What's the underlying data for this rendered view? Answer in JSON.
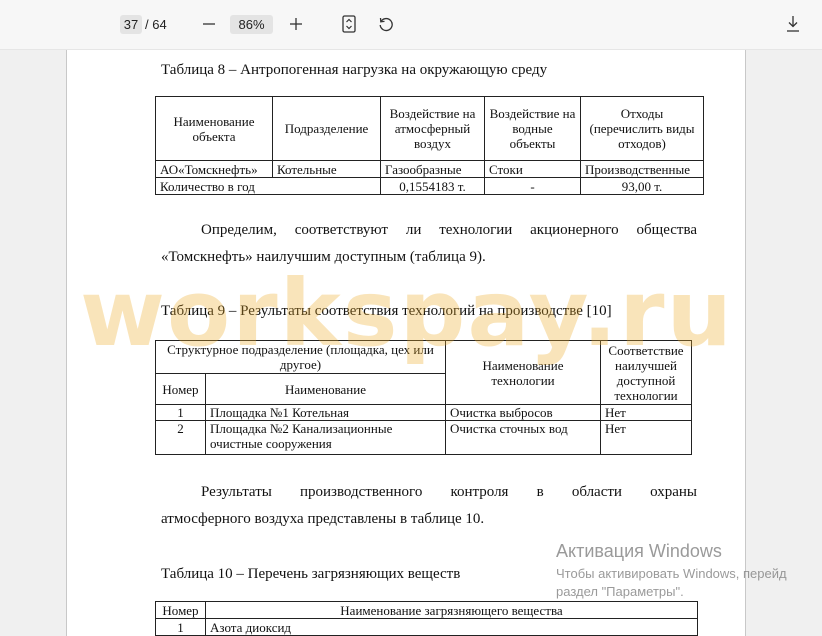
{
  "toolbar": {
    "current_page": "37",
    "total_pages": "/ 64",
    "zoom": "86%",
    "icons": [
      "minus-icon",
      "plus-icon",
      "fit-page-icon",
      "rotate-icon",
      "download-icon"
    ]
  },
  "document": {
    "table8": {
      "caption": "Таблица 8 – Антропогенная нагрузка на окружающую среду",
      "headers": [
        "Наименование объекта",
        "Подразделение",
        "Воздействие на атмосферный воздух",
        "Воздействие на водные объекты",
        "Отходы (перечислить виды отходов)"
      ],
      "row1": [
        "АО«Томскнефть»",
        "Котельные",
        "Газообразные",
        "Стоки",
        "Производственные"
      ],
      "row2": [
        "Количество в год",
        "0,1554183 т.",
        "-",
        "93,00 т."
      ]
    },
    "paragraph1": {
      "line1": "Определим, соответствуют ли технологии акционерного общества",
      "line2": "«Томскнефть» наилучшим доступным (таблица 9)."
    },
    "table9": {
      "caption": "Таблица 9 – Результаты соответствия технологий на производстве [10]",
      "group_header": "Структурное подразделение (площадка, цех или другое)",
      "col_number": "Номер",
      "col_name": "Наименование",
      "col_tech": "Наименование технологии",
      "col_bat": "Соответствие наилучшей доступной технологии",
      "rows": [
        {
          "number": "1",
          "name": "Площадка №1 Котельная",
          "tech": "Очистка выбросов",
          "bat": "Нет"
        },
        {
          "number": "2",
          "name": "Площадка №2 Канализационные очистные сооружения",
          "tech": "Очистка сточных вод",
          "bat": "Нет"
        }
      ]
    },
    "paragraph2": {
      "line1": "Результаты производственного контроля в области охраны",
      "line2": "атмосферного воздуха представлены в таблице 10."
    },
    "table10": {
      "caption": "Таблица 10 – Перечень загрязняющих веществ",
      "col_number": "Номер",
      "col_name": "Наименование загрязняющего вещества",
      "row1": [
        "1",
        "Азота диоксид"
      ]
    }
  },
  "watermark": "workspay.ru",
  "activation": {
    "title": "Активация Windows",
    "line1": "Чтобы активировать Windows, перейд",
    "line2": "раздел \"Параметры\"."
  },
  "colors": {
    "toolbar_bg": "#f7f7f7",
    "viewer_bg": "#f0f0f0",
    "watermark": "#ebaa28"
  }
}
